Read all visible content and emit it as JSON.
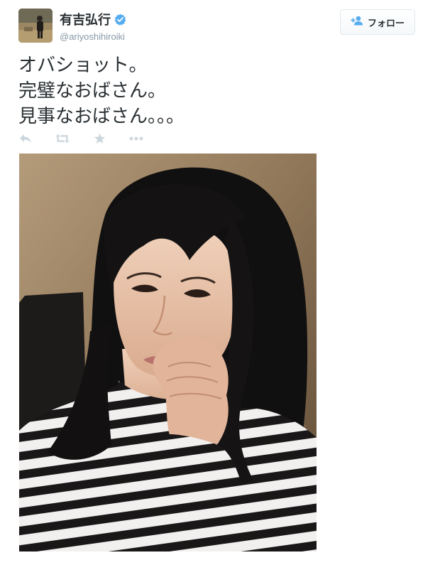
{
  "tweet": {
    "author": {
      "fullname": "有吉弘行",
      "username": "@ariyoshihiroiki",
      "verified": true
    },
    "follow_button": {
      "label": "フォロー",
      "icon": "add-user-icon"
    },
    "text_lines": [
      "オバショット。",
      "完璧なおばさん。",
      "見事なおばさん。。。"
    ],
    "actions": [
      {
        "name": "reply",
        "icon": "reply-icon"
      },
      {
        "name": "retweet",
        "icon": "retweet-icon"
      },
      {
        "name": "favorite",
        "icon": "star-icon"
      },
      {
        "name": "more",
        "icon": "more-icon"
      }
    ],
    "media": {
      "type": "photo"
    },
    "colors": {
      "text": "#292f33",
      "muted": "#8899a6",
      "action_icon": "#ccd6dd",
      "verified": "#55acee",
      "follow_icon": "#55acee",
      "button_border": "#e1e8ed"
    }
  }
}
